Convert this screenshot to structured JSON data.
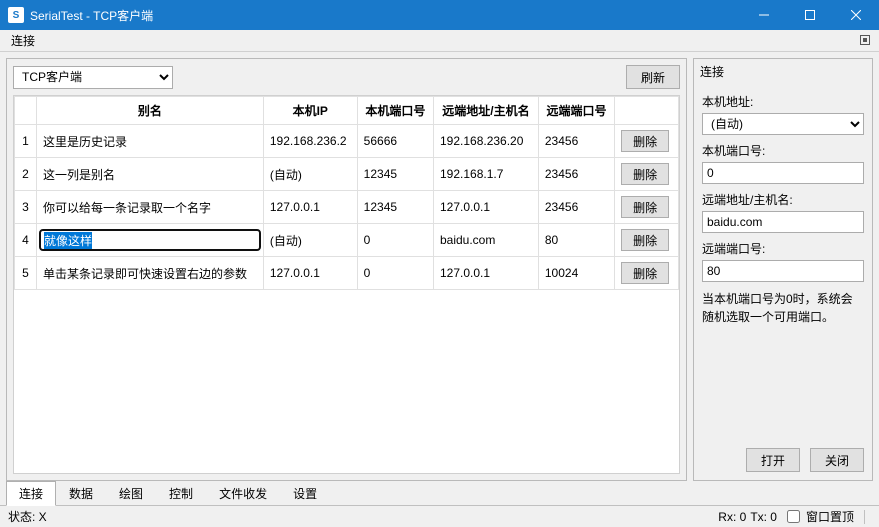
{
  "window": {
    "title": "SerialTest - TCP客户端"
  },
  "menu": {
    "connect": "连接"
  },
  "mode": {
    "selected": "TCP客户端",
    "refresh": "刷新"
  },
  "table": {
    "headers": {
      "idx": "",
      "alias": "别名",
      "local_ip": "本机IP",
      "local_port": "本机端口号",
      "remote_addr": "远端地址/主机名",
      "remote_port": "远端端口号",
      "action": ""
    },
    "delete_label": "删除",
    "rows": [
      {
        "n": "1",
        "alias": "这里是历史记录",
        "local_ip": "192.168.236.2",
        "local_port": "56666",
        "remote_addr": "192.168.236.20",
        "remote_port": "23456"
      },
      {
        "n": "2",
        "alias": "这一列是别名",
        "local_ip": "(自动)",
        "local_port": "12345",
        "remote_addr": "192.168.1.7",
        "remote_port": "23456"
      },
      {
        "n": "3",
        "alias": "你可以给每一条记录取一个名字",
        "local_ip": "127.0.0.1",
        "local_port": "12345",
        "remote_addr": "127.0.0.1",
        "remote_port": "23456"
      },
      {
        "n": "4",
        "alias": "就像这样",
        "local_ip": "(自动)",
        "local_port": "0",
        "remote_addr": "baidu.com",
        "remote_port": "80",
        "editing": true
      },
      {
        "n": "5",
        "alias": "单击某条记录即可快速设置右边的参数",
        "local_ip": "127.0.0.1",
        "local_port": "0",
        "remote_addr": "127.0.0.1",
        "remote_port": "10024"
      }
    ]
  },
  "panel": {
    "title": "连接",
    "local_addr_label": "本机地址:",
    "local_addr_value": "(自动)",
    "local_port_label": "本机端口号:",
    "local_port_value": "0",
    "remote_addr_label": "远端地址/主机名:",
    "remote_addr_value": "baidu.com",
    "remote_port_label": "远端端口号:",
    "remote_port_value": "80",
    "hint": "当本机端口号为0时，系统会随机选取一个可用端口。",
    "open": "打开",
    "close": "关闭"
  },
  "tabs": {
    "items": [
      "连接",
      "数据",
      "绘图",
      "控制",
      "文件收发",
      "设置"
    ],
    "active": 0
  },
  "status": {
    "left": "状态: X",
    "rx": "Rx: 0",
    "tx": "Tx: 0",
    "ontop": "窗口置顶"
  }
}
